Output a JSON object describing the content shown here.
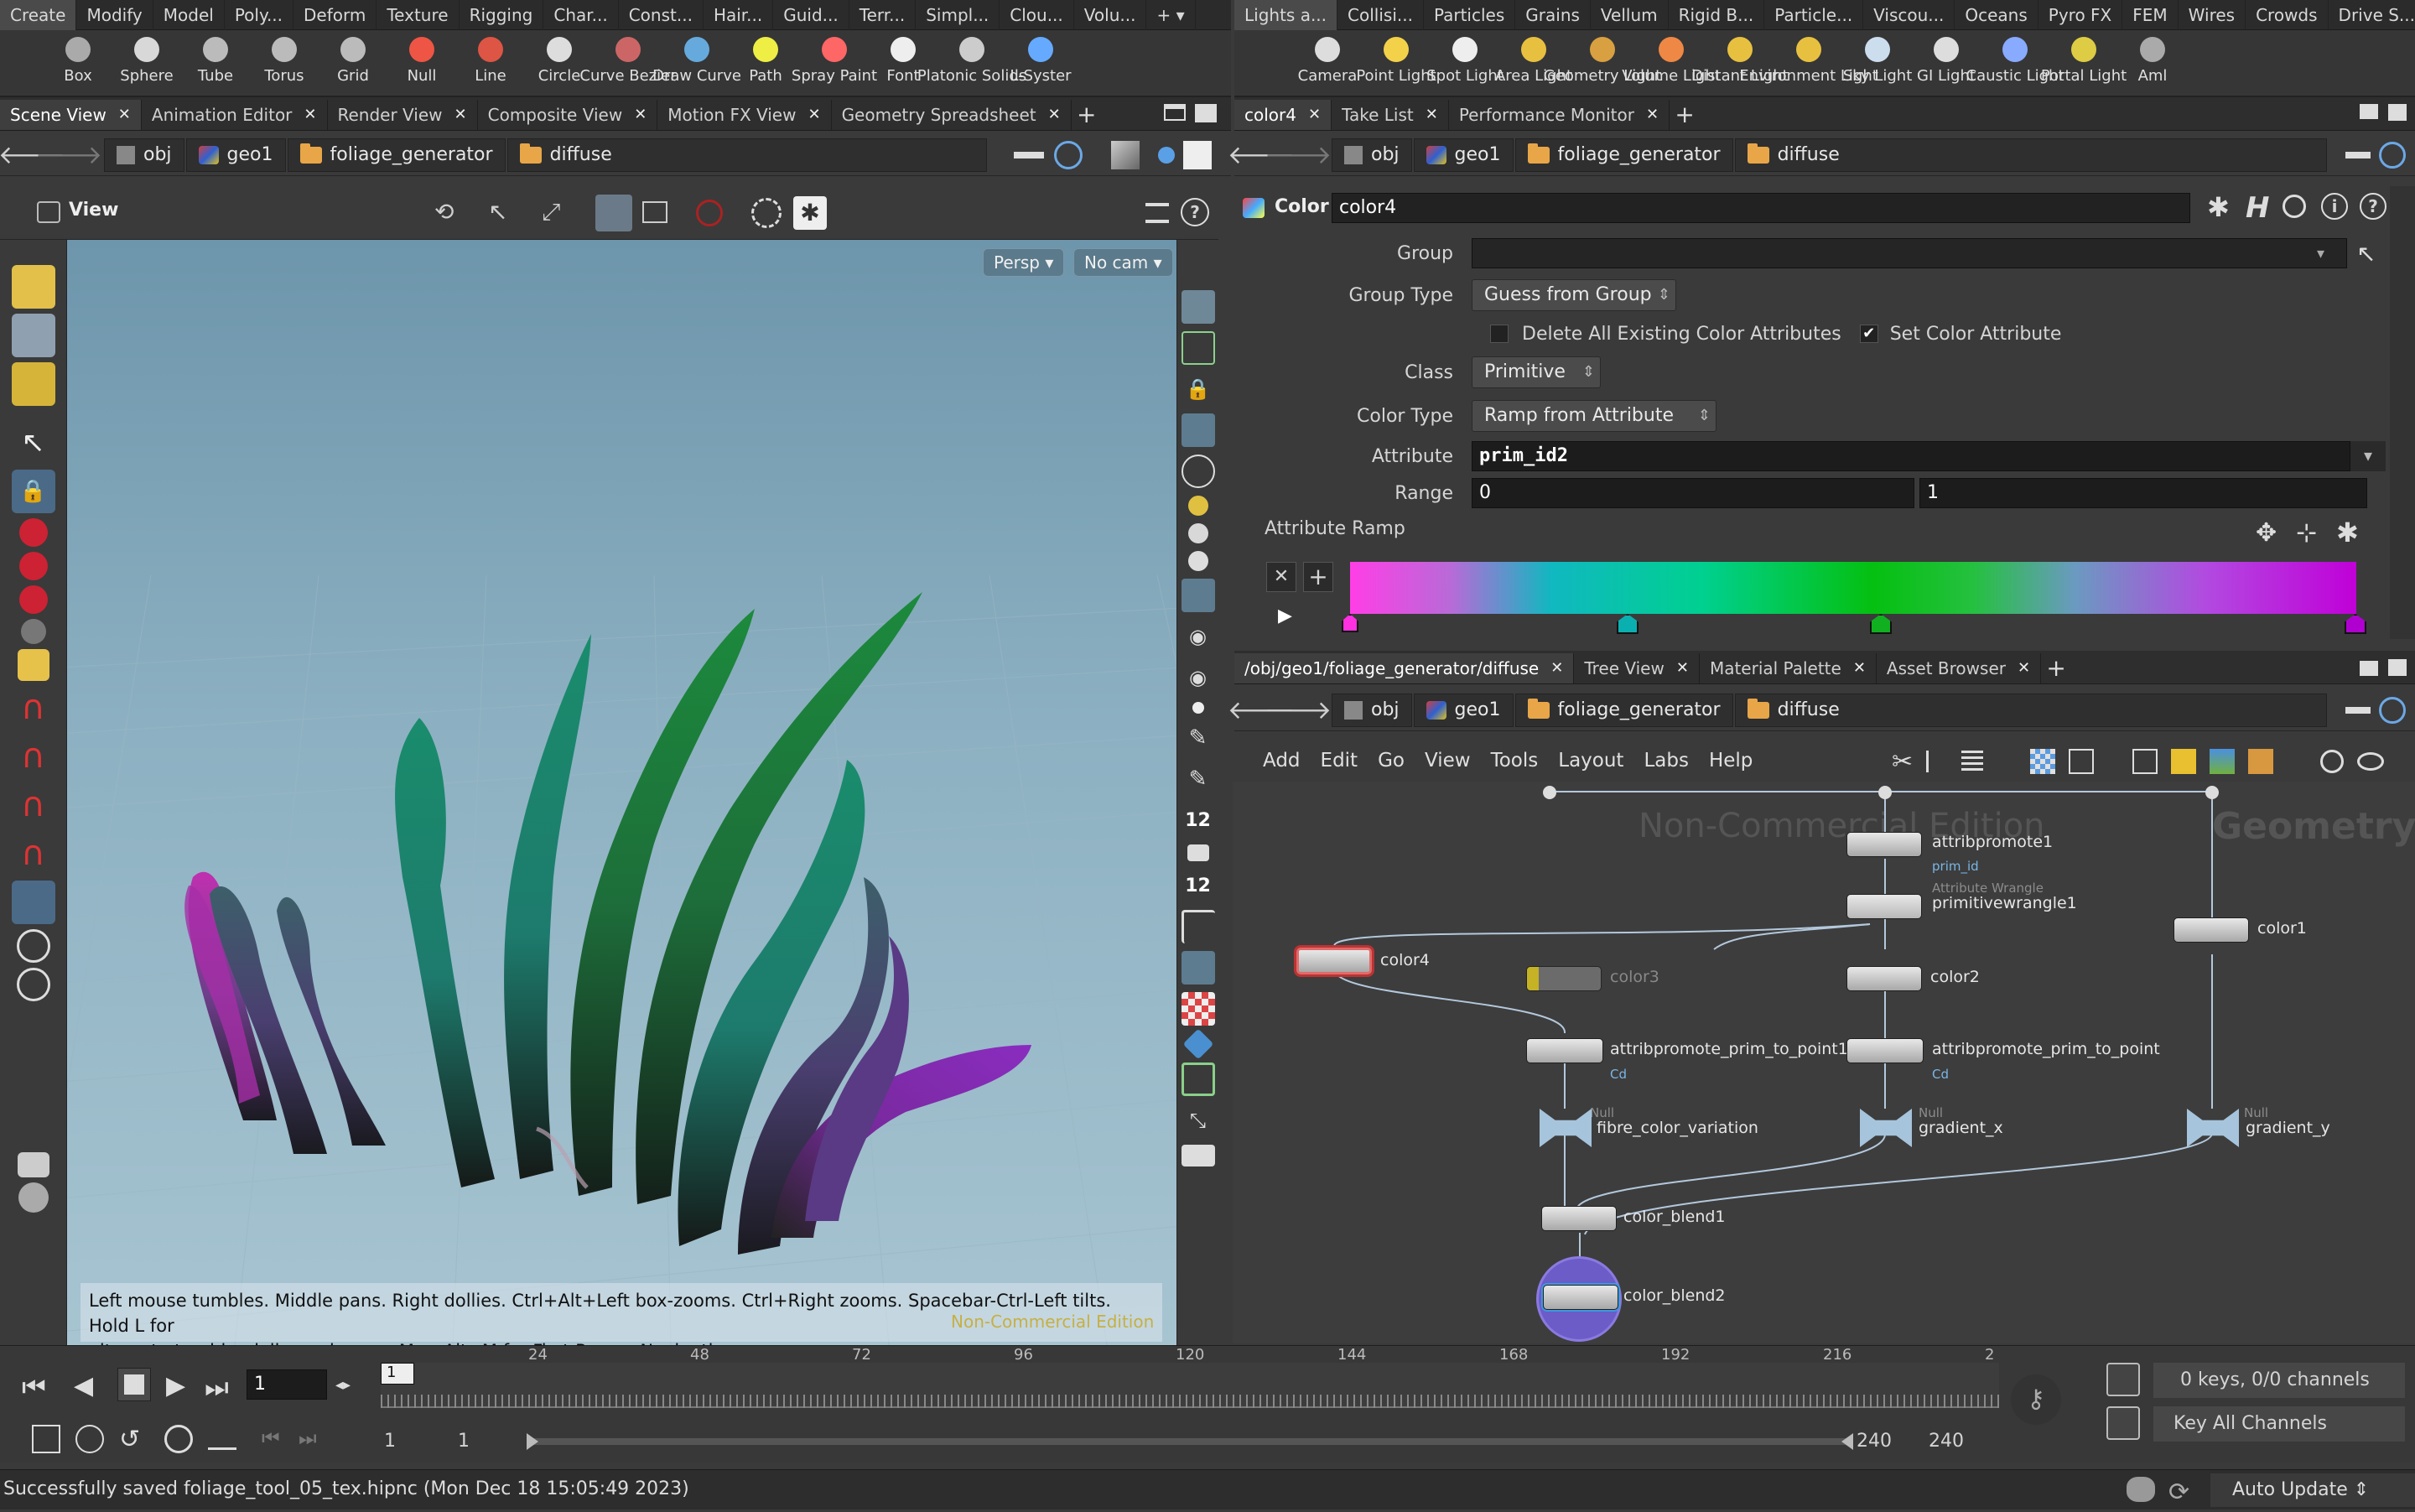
{
  "left_menu": [
    "Create",
    "Modify",
    "Model",
    "Poly...",
    "Deform",
    "Texture",
    "Rigging",
    "Char...",
    "Const...",
    "Hair...",
    "Guid...",
    "Terr...",
    "Simpl...",
    "Clou...",
    "Volu..."
  ],
  "right_menu": [
    "Lights a...",
    "Collisi...",
    "Particles",
    "Grains",
    "Vellum",
    "Rigid B...",
    "Particle...",
    "Viscou...",
    "Oceans",
    "Pyro FX",
    "FEM",
    "Wires",
    "Crowds",
    "Drive S..."
  ],
  "left_shelf": [
    "Box",
    "Sphere",
    "Tube",
    "Torus",
    "Grid",
    "Null",
    "Line",
    "Circle",
    "Curve Bezier",
    "Draw Curve",
    "Path",
    "Spray Paint",
    "Font",
    "Platonic Solids",
    "L-Syster"
  ],
  "right_shelf": [
    "Camera",
    "Point Light",
    "Spot Light",
    "Area Light",
    "Geometry Light",
    "Volume Light",
    "Distant Light",
    "Environment Light",
    "Sky Light",
    "GI Light",
    "Caustic Light",
    "Portal Light",
    "Aml"
  ],
  "left_tabs": [
    "Scene View",
    "Animation Editor",
    "Render View",
    "Composite View",
    "Motion FX View",
    "Geometry Spreadsheet"
  ],
  "param_tabs": [
    "color4",
    "Take List",
    "Performance Monitor"
  ],
  "net_tabs": [
    "/obj/geo1/foliage_generator/diffuse",
    "Tree View",
    "Material Palette",
    "Asset Browser"
  ],
  "path": {
    "obj": "obj",
    "geo": "geo1",
    "fg": "foliage_generator",
    "diffuse": "diffuse"
  },
  "viewport": {
    "title": "View",
    "persp": "Persp",
    "cam": "No cam",
    "help_line1": "Left mouse tumbles. Middle pans. Right dollies. Ctrl+Alt+Left box-zooms. Ctrl+Right zooms. Spacebar-Ctrl-Left tilts. Hold L for",
    "help_line2": "alternate tumble, dolly, and zoom.     M or Alt+M for First Person Navigation.",
    "watermark": "Non-Commercial Edition"
  },
  "params": {
    "node_type": "Color",
    "node_name": "color4",
    "group_label": "Group",
    "group_value": "",
    "group_type_label": "Group Type",
    "group_type_value": "Guess from Group",
    "delete_label": "Delete All Existing Color Attributes",
    "set_label": "Set Color Attribute",
    "class_label": "Class",
    "class_value": "Primitive",
    "color_type_label": "Color Type",
    "color_type_value": "Ramp from Attribute",
    "attribute_label": "Attribute",
    "attribute_value": "prim_id2",
    "range_label": "Range",
    "range_min": "0",
    "range_max": "1",
    "ramp_label": "Attribute Ramp"
  },
  "network": {
    "menu": [
      "Add",
      "Edit",
      "Go",
      "View",
      "Tools",
      "Layout",
      "Labs",
      "Help"
    ],
    "watermark": "Non-Commercial Edition",
    "context": "Geometry",
    "nodes": {
      "attribpromote1": "attribpromote1",
      "attribpromote1_sub": "prim_id",
      "primitivewrangle1": "primitivewrangle1",
      "primitivewrangle1_type": "Attribute Wrangle",
      "color1": "color1",
      "color2": "color2",
      "color3": "color3",
      "color4": "color4",
      "apt1": "attribpromote_prim_to_point1",
      "apt1_sub": "Cd",
      "apt2": "attribpromote_prim_to_point",
      "apt2_sub": "Cd",
      "null_type": "Null",
      "fibre": "fibre_color_variation",
      "gx": "gradient_x",
      "gy": "gradient_y",
      "blend1": "color_blend1",
      "blend2": "color_blend2"
    }
  },
  "timeline": {
    "frame": "1",
    "ticks": [
      "24",
      "48",
      "72",
      "96",
      "120",
      "144",
      "168",
      "192",
      "216",
      "2"
    ],
    "start": "1",
    "start2": "1",
    "end": "240",
    "end2": "240",
    "keys": "0 keys, 0/0 channels",
    "key_all": "Key All Channels",
    "marker": "1"
  },
  "status": {
    "message": "Successfully saved foliage_tool_05_tex.hipnc (Mon Dec 18 15:05:49 2023)",
    "auto_update": "Auto Update"
  }
}
